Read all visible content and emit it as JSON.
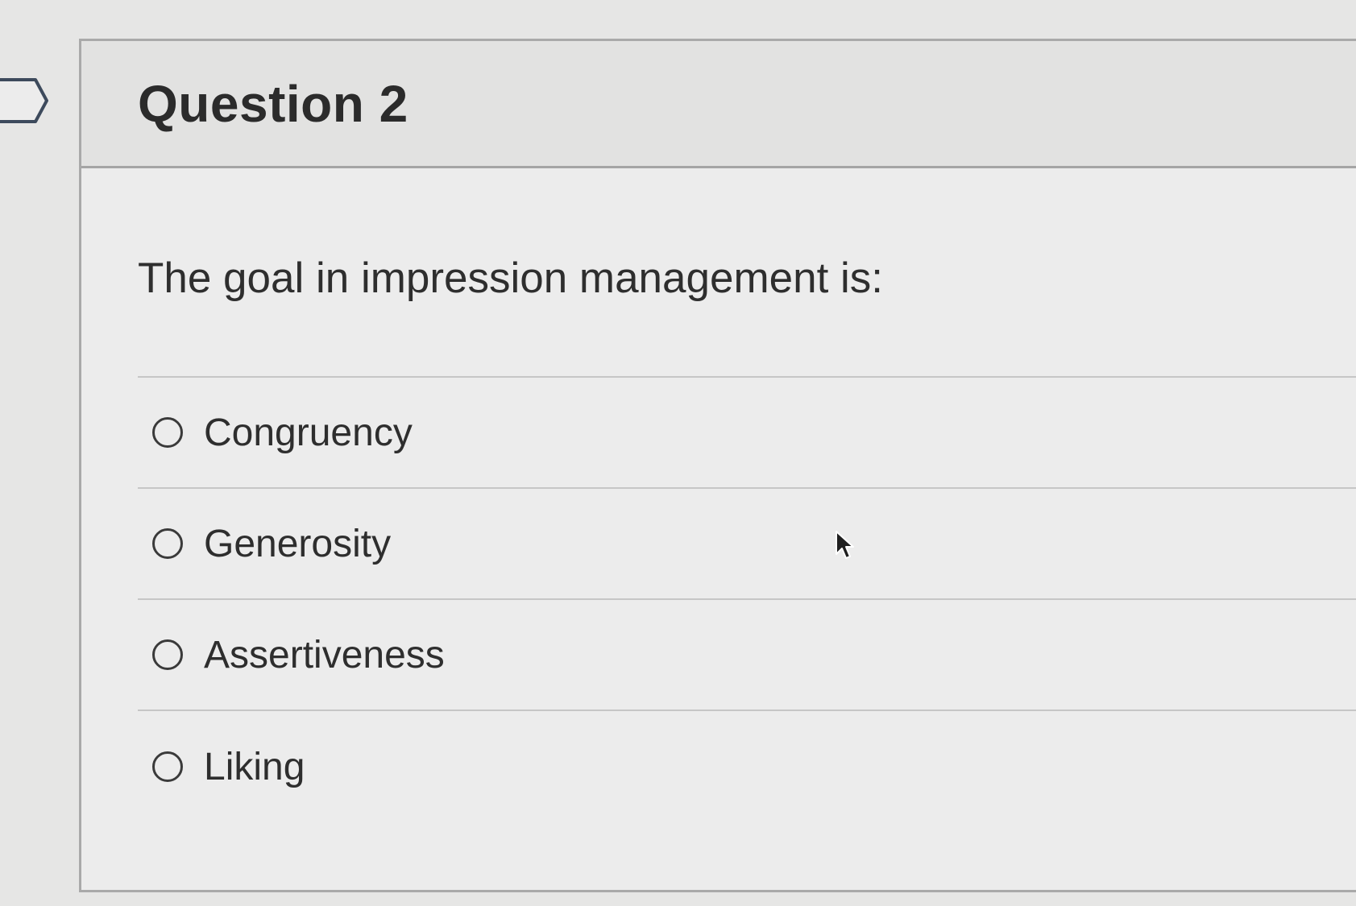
{
  "question": {
    "title": "Question 2",
    "prompt": "The goal in impression management is:",
    "options": [
      {
        "label": "Congruency",
        "selected": false
      },
      {
        "label": "Generosity",
        "selected": false
      },
      {
        "label": "Assertiveness",
        "selected": false
      },
      {
        "label": "Liking",
        "selected": false
      }
    ]
  },
  "icons": {
    "flag": "flag-marker-icon",
    "radio": "radio-circle-icon",
    "cursor": "mouse-pointer-icon"
  },
  "colors": {
    "background": "#e6e6e5",
    "text": "#2d2d2d",
    "border": "#a9a9a9"
  }
}
